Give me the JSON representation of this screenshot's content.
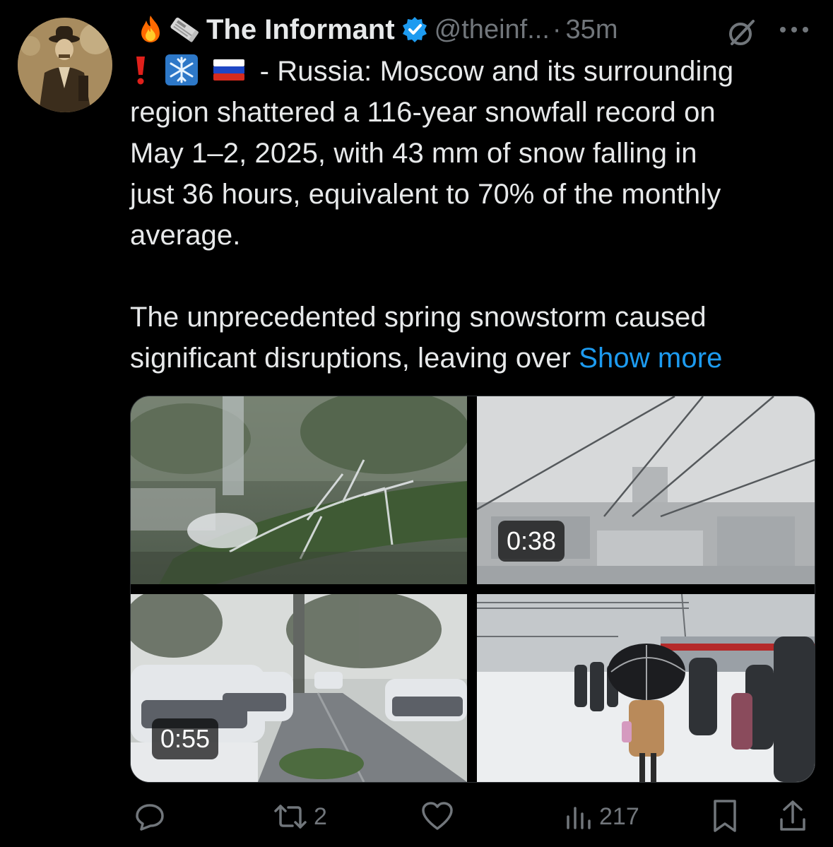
{
  "author": {
    "name": "The Informant",
    "handle": "@theinf...",
    "separator": "·",
    "time": "35m"
  },
  "header_icons": [
    "fire-emoji",
    "newspaper-emoji",
    "verified-badge-icon",
    "grok-icon",
    "more-icon"
  ],
  "tweet": {
    "line1_emoji": [
      "exclamation-emoji",
      "snowflake-emoji",
      "russia-flag-emoji"
    ],
    "lines": [
      "- Russia: Moscow and its surrounding",
      "region shattered a 116-year snowfall record on",
      "May 1–2, 2025, with 43 mm of snow falling in",
      "just 36 hours, equivalent to 70% of the monthly",
      "average."
    ],
    "paragraph2_lines": [
      "The unprecedented spring snowstorm caused",
      "significant disruptions, leaving over"
    ],
    "show_more": "Show more"
  },
  "media": {
    "tiles": [
      {
        "description_icon": "fallen-snowy-tree-image"
      },
      {
        "description_icon": "snowy-city-power-lines-image",
        "duration": "0:38"
      },
      {
        "description_icon": "snowy-street-parked-cars-image",
        "duration": "0:55"
      },
      {
        "description_icon": "people-on-snowy-train-platform-image"
      }
    ]
  },
  "actions": {
    "reply_count": "",
    "retweet_count": "2",
    "like_count": "",
    "views_count": "217"
  },
  "colors": {
    "background": "#000000",
    "text": "#e7e9ea",
    "secondary": "#71767b",
    "link": "#1d9bf0",
    "verified": "#1d9bf0"
  }
}
